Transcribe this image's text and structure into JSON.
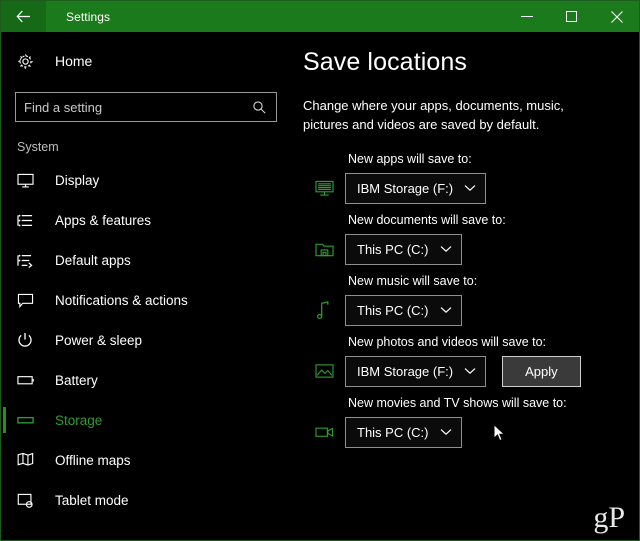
{
  "titlebar": {
    "back_icon": "back-arrow-icon",
    "title": "Settings",
    "minimize_label": "Minimize",
    "maximize_label": "Maximize",
    "close_label": "Close",
    "accent_color": "#1b7a1b"
  },
  "sidebar": {
    "home": {
      "label": "Home",
      "icon": "gear-icon"
    },
    "search": {
      "value": "",
      "placeholder": "Find a setting",
      "icon": "search-icon"
    },
    "section": "System",
    "selected": "Storage",
    "accent_color": "#23921f",
    "items": [
      {
        "label": "Display",
        "icon": "monitor-icon",
        "selected": false
      },
      {
        "label": "Apps & features",
        "icon": "list-icon",
        "selected": false
      },
      {
        "label": "Default apps",
        "icon": "list-arrow-icon",
        "selected": false
      },
      {
        "label": "Notifications & actions",
        "icon": "speech-bubble-icon",
        "selected": false
      },
      {
        "label": "Power & sleep",
        "icon": "power-icon",
        "selected": false
      },
      {
        "label": "Battery",
        "icon": "battery-icon",
        "selected": false
      },
      {
        "label": "Storage",
        "icon": "storage-icon",
        "selected": true
      },
      {
        "label": "Offline maps",
        "icon": "map-icon",
        "selected": false
      },
      {
        "label": "Tablet mode",
        "icon": "tablet-icon",
        "selected": false
      }
    ]
  },
  "content": {
    "title": "Save locations",
    "description": "Change where your apps, documents, music, pictures and videos are saved by default.",
    "icon_color": "#2e9e2e",
    "apply_label": "Apply",
    "rows": [
      {
        "label": "New apps will save to:",
        "icon": "apps-monitor-icon",
        "value": "IBM Storage (F:)",
        "has_apply": false
      },
      {
        "label": "New documents will save to:",
        "icon": "documents-folder-icon",
        "value": "This PC (C:)",
        "has_apply": false
      },
      {
        "label": "New music will save to:",
        "icon": "music-note-icon",
        "value": "This PC (C:)",
        "has_apply": false
      },
      {
        "label": "New photos and videos will save to:",
        "icon": "photo-icon",
        "value": "IBM Storage (F:)",
        "has_apply": true
      },
      {
        "label": "New movies and TV shows will save to:",
        "icon": "video-camera-icon",
        "value": "This PC (C:)",
        "has_apply": false
      }
    ]
  },
  "watermark": {
    "text": "gP"
  }
}
